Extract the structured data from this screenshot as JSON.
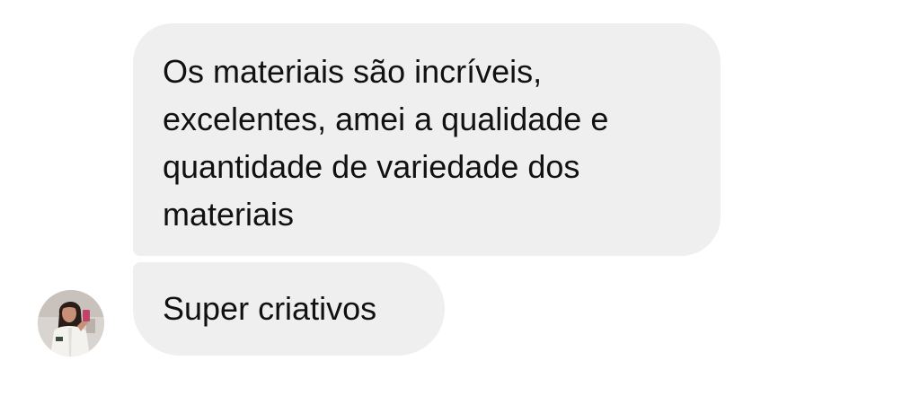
{
  "messages": [
    {
      "text": "Os materiais são incríveis, excelentes, amei a qualidade e quantidade de variedade dos materiais"
    },
    {
      "text": "Super criativos"
    }
  ],
  "avatar": {
    "icon": "profile-photo",
    "colors": {
      "background": "#d9d4cf",
      "hair": "#2a1d18",
      "skin": "#c89078",
      "coat": "#f4f2ef",
      "phone": "#c0436a"
    }
  },
  "colors": {
    "bubble": "#efefef",
    "text": "#111111",
    "page": "#ffffff"
  }
}
